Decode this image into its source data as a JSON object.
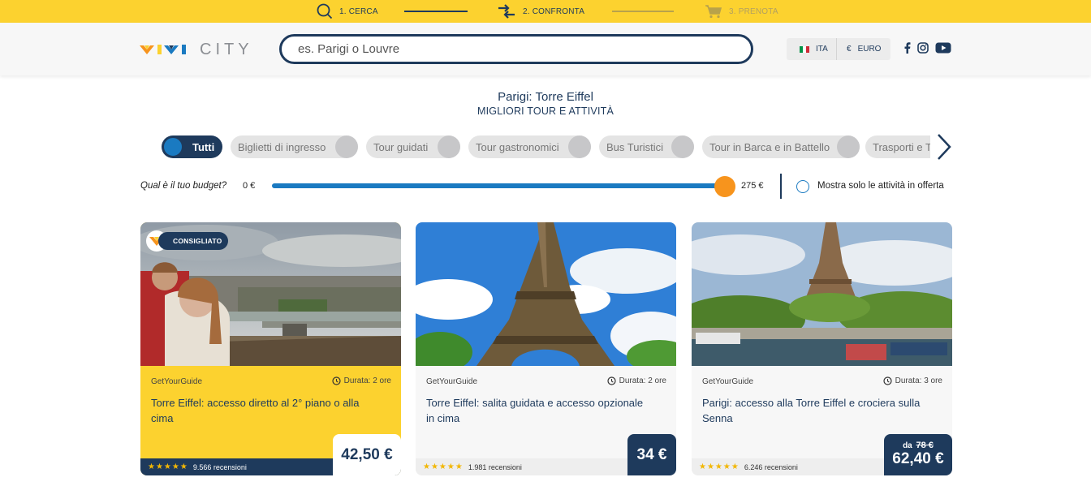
{
  "steps": [
    {
      "label": "1. CERCA"
    },
    {
      "label": "2. CONFRONTA"
    },
    {
      "label": "3. PRENOTA"
    }
  ],
  "header": {
    "logo_text": "CITY",
    "search_placeholder": "es. Parigi o Louvre",
    "language": "ITA",
    "currency_symbol": "€",
    "currency": "EURO",
    "flag_colors": [
      "#009246",
      "#ffffff",
      "#ce2b37"
    ]
  },
  "page": {
    "title": "Parigi: Torre Eiffel",
    "subtitle": "MIGLIORI TOUR E ATTIVITÀ"
  },
  "categories": [
    {
      "label": "Tutti",
      "active": true
    },
    {
      "label": "Biglietti di ingresso"
    },
    {
      "label": "Tour guidati"
    },
    {
      "label": "Tour gastronomici"
    },
    {
      "label": "Bus Turistici"
    },
    {
      "label": "Tour in Barca e in Battello"
    },
    {
      "label": "Trasporti e Tr"
    }
  ],
  "budget": {
    "label": "Qual è il tuo budget?",
    "min": "0 €",
    "max": "275 €",
    "offer_label": "Mostra solo le attività in offerta"
  },
  "cards": [
    {
      "badge": "CONSIGLIATO",
      "provider": "GetYourGuide",
      "duration": "Durata: 2 ore",
      "title": "Torre Eiffel: accesso diretto al 2° piano o alla cima",
      "stars": "★★★★★",
      "reviews": "9.566 recensioni",
      "price": "42,50 €"
    },
    {
      "provider": "GetYourGuide",
      "duration": "Durata: 2 ore",
      "title": "Torre Eiffel: salita guidata e accesso opzionale in cima",
      "stars": "★★★★★",
      "reviews": "1.981 recensioni",
      "price": "34 €"
    },
    {
      "provider": "GetYourGuide",
      "duration": "Durata: 3 ore",
      "title": "Parigi: accesso alla Torre Eiffel e crociera sulla Senna",
      "stars": "★★★★★",
      "reviews": "6.246 recensioni",
      "price_from": "da",
      "old_price": "78 €",
      "price": "62,40 €"
    }
  ],
  "colors": {
    "brand_yellow": "#fcd22f",
    "navy": "#1e3a5c",
    "blue": "#1a7ac1",
    "orange": "#f7941d"
  }
}
